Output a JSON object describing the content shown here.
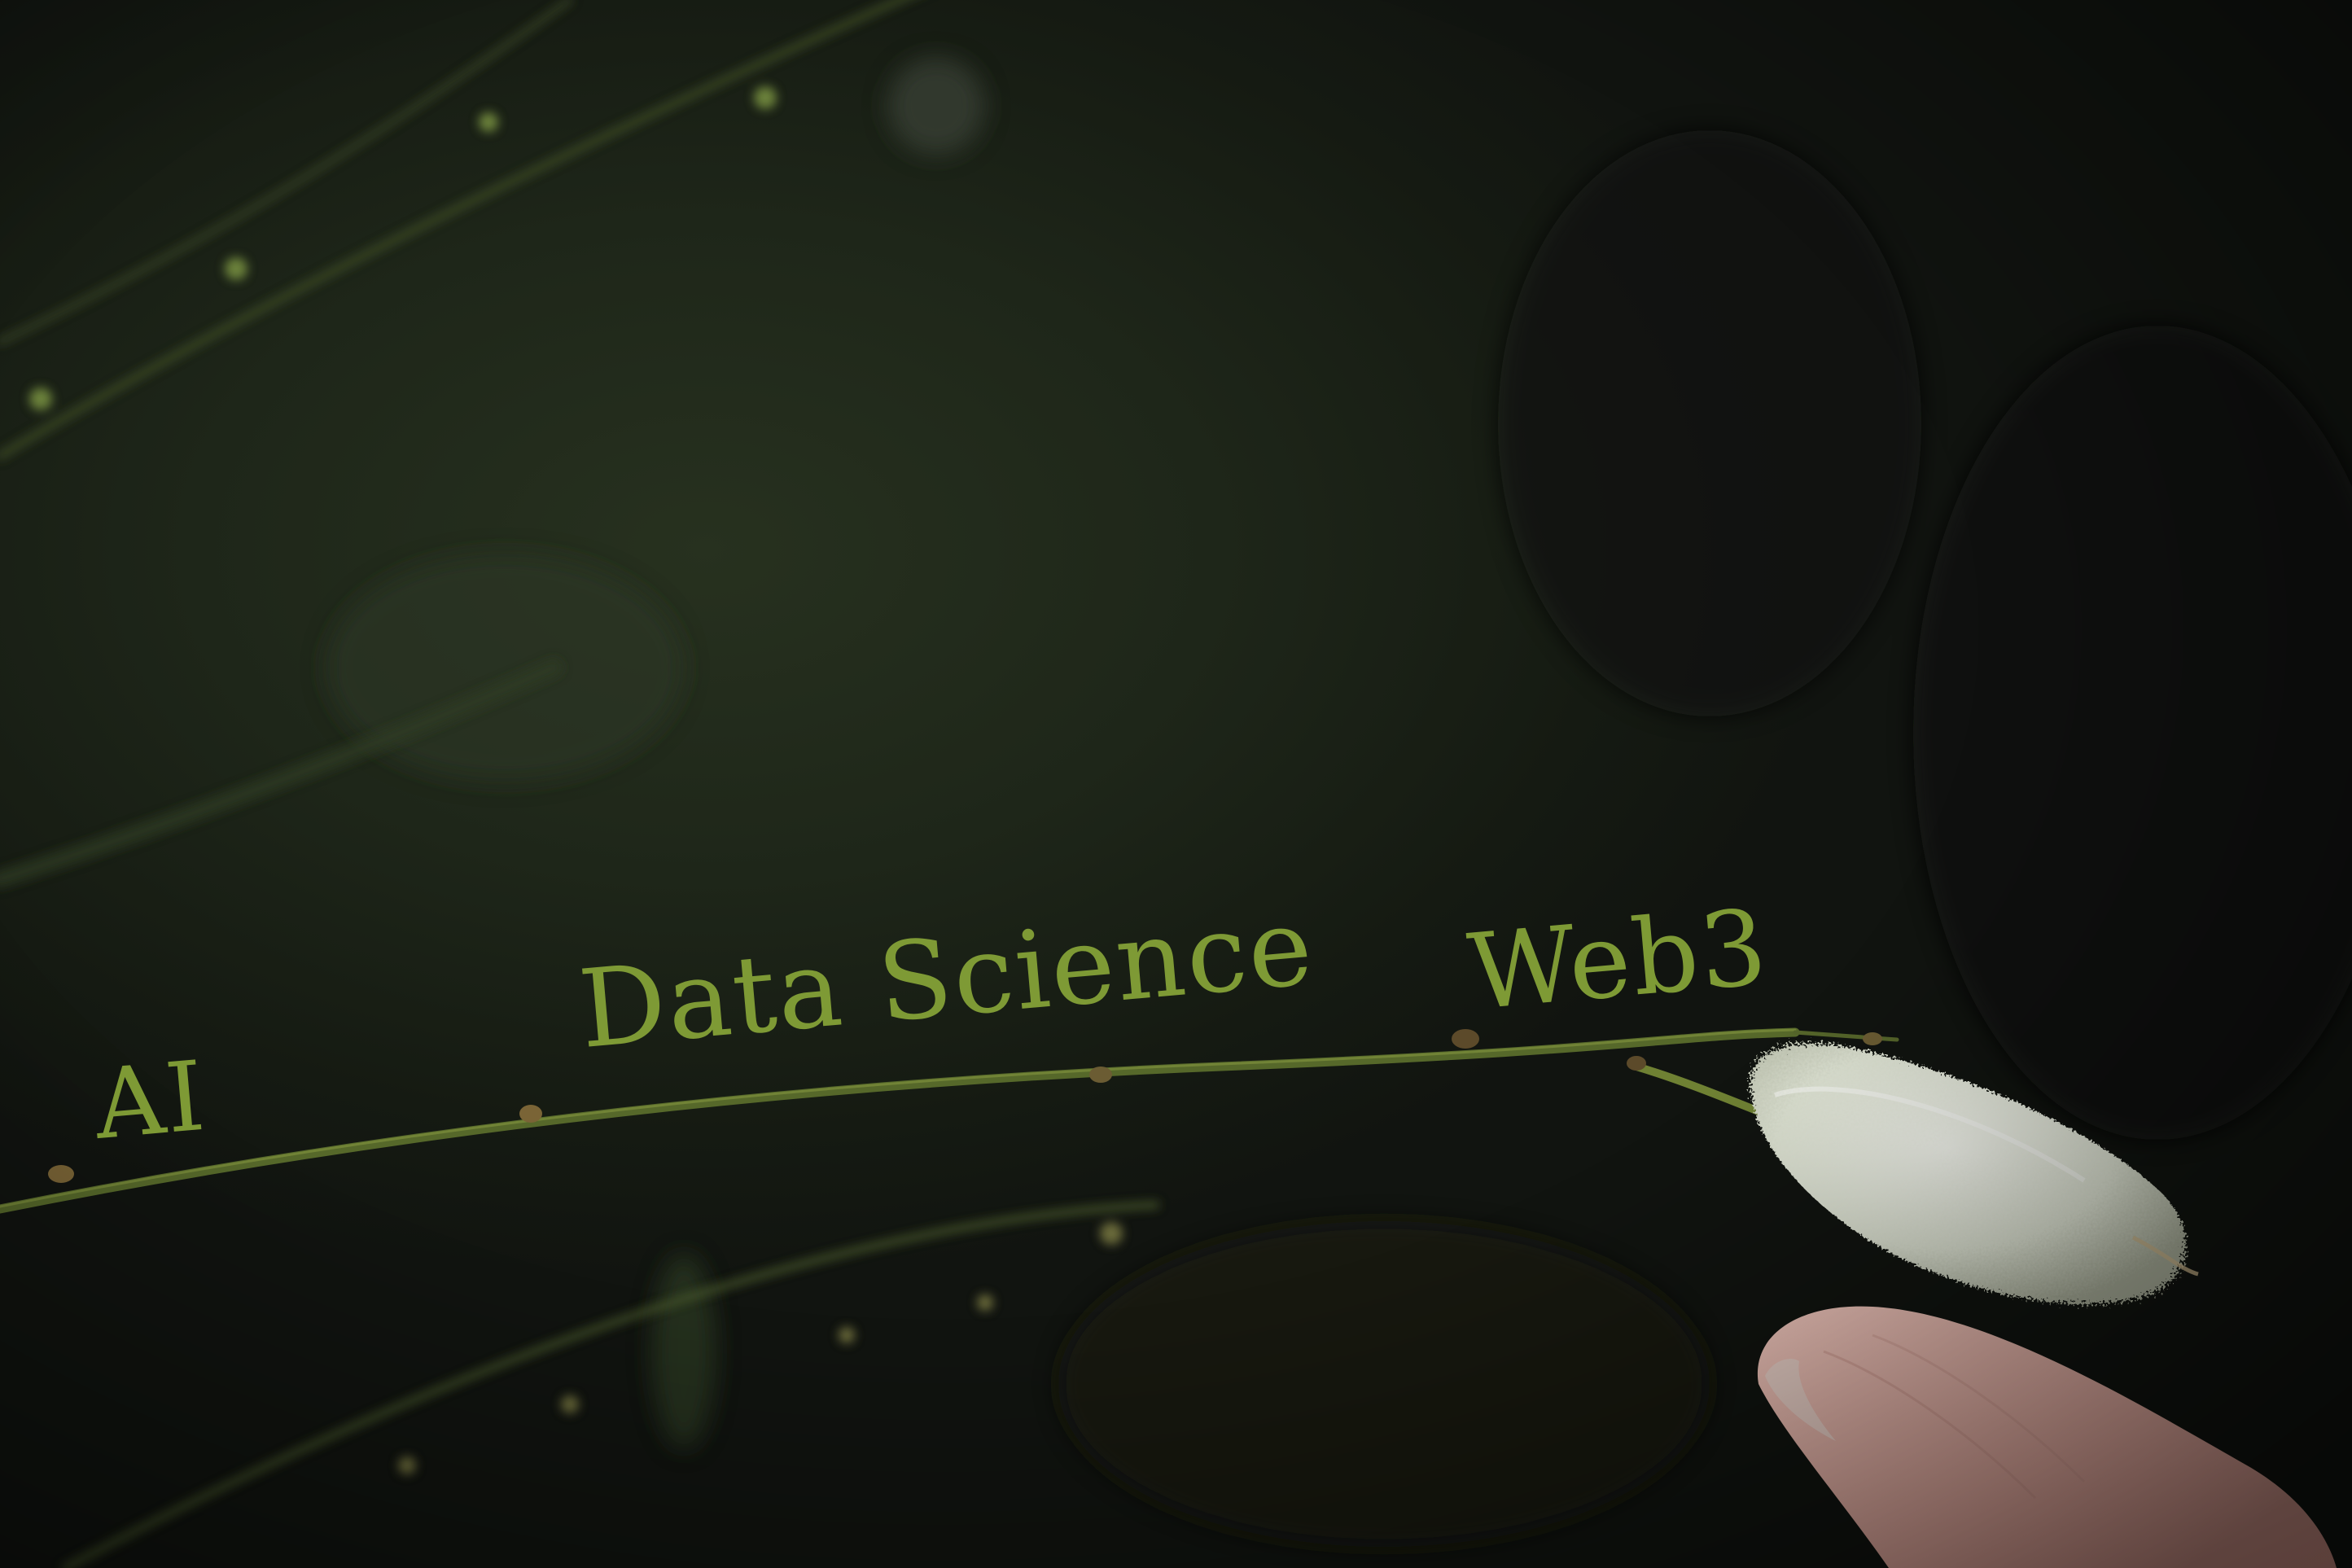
{
  "labels": {
    "first": "AI",
    "second": "Data Science",
    "third": "Web3"
  },
  "colors": {
    "label_text": "#7e9a35",
    "background": "#1c2418",
    "stem": "#5a6b26",
    "bud": "#e8ece0",
    "finger": "#e2b2a8"
  }
}
